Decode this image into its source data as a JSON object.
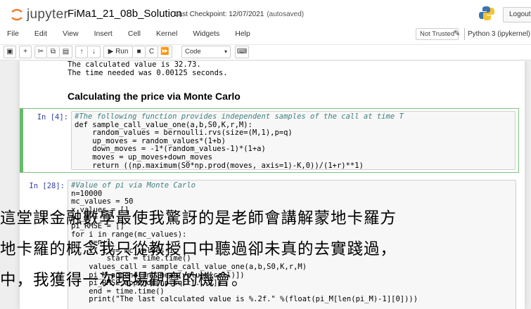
{
  "header": {
    "logo_text": "jupyter",
    "notebook_name": "FiMa1_21_08b_Solution",
    "checkpoint_label": "Last Checkpoint: 12/07/2021",
    "autosaved": "(autosaved)",
    "logout_label": "Logout"
  },
  "menu": [
    "File",
    "Edit",
    "View",
    "Insert",
    "Cell",
    "Kernel",
    "Widgets",
    "Help"
  ],
  "status": {
    "trust": "Not Trusted",
    "kernel": "Python 3 (ipykernel)"
  },
  "toolbar": {
    "run_label": "Run",
    "cell_type": "Code",
    "icons": [
      "save-icon",
      "add-cell-icon",
      "cut-icon",
      "copy-icon",
      "paste-icon",
      "move-up-icon",
      "move-down-icon",
      "run-icon",
      "stop-icon",
      "restart-icon",
      "fast-forward-icon",
      "command-palette-icon"
    ]
  },
  "notebook": {
    "output_lines": [
      "The calculated value is 32.73.",
      "The time needed was 0.00125 seconds."
    ],
    "heading": "Calculating the price via Monte Carlo",
    "cell1": {
      "prompt": "In [4]:",
      "lines": [
        "#The following function provides independent samples of the call at time T",
        "def sample_call_value_one(a,b,S0,K,r,M):",
        "    random_values = bernoulli.rvs(size=(M,1),p=q)",
        "    up_moves = random_values*(1+b)",
        "    down_moves = -1*(random_values-1)*(1+a)",
        "    moves = up_moves+down_moves",
        "    return ((np.maximum(S0*np.prod(moves, axis=1)-K,0))/(1+r)**1)"
      ]
    },
    "cell2": {
      "prompt": "In [28]:",
      "lines": [
        "#Value of pi via Monte Carlo",
        "n=10000",
        "mc_values = 50",
        "x_values = []",
        "pi_M = []",
        "pi_RMSE = []",
        "for i in range(mc_values):",
        "    n=n+1",
        "    if i == mc_values-1:",
        "        start = time.time()",
        "    values_call = sample_call_value_one(a,b,S0,K,r,M)",
        "    pi_M.append([np.mean(values_call)])",
        "    pi_RMSE.append([np.sqrt(...)])",
        "    end = time.time()",
        "    print(\"The last calculated value is %.2f.\" %(float(pi_M[len(pi_M)-1][0])))"
      ]
    }
  },
  "overlay": {
    "lines": [
      "這堂課金融數學最使我驚訝的是老師會講解蒙地卡羅方",
      "地卡羅的概念我只從教授口中聽過卻未真的去實踐過，",
      "中，我獲得一次現場觀摩的機會。"
    ]
  },
  "colors": {
    "selected_cell_border": "#66bb6a",
    "prompt": "#303f9f",
    "comment": "#408080",
    "keyword": "#008000"
  }
}
